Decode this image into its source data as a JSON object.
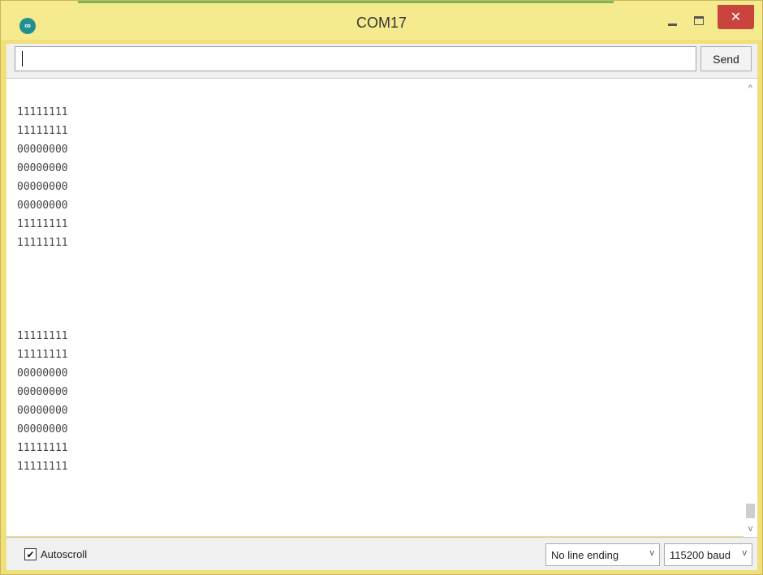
{
  "window": {
    "title": "COM17",
    "app_icon_glyph": "∞",
    "close_glyph": "✕"
  },
  "input": {
    "value": "",
    "send_label": "Send"
  },
  "output": {
    "lines": [
      "11111111",
      "11111111",
      "00000000",
      "00000000",
      "00000000",
      "00000000",
      "11111111",
      "11111111",
      "",
      "",
      "",
      "",
      "11111111",
      "11111111",
      "00000000",
      "00000000",
      "00000000",
      "00000000",
      "11111111",
      "11111111"
    ],
    "scroll_up_glyph": "^",
    "scroll_down_glyph": "v"
  },
  "status": {
    "autoscroll_label": "Autoscroll",
    "autoscroll_checked": true,
    "line_ending": "No line ending",
    "baud": "115200 baud",
    "chevron_glyph": "v"
  },
  "colors": {
    "window_frame": "#f0e07a",
    "close_button": "#c8443c",
    "app_icon": "#1f8f8f"
  }
}
